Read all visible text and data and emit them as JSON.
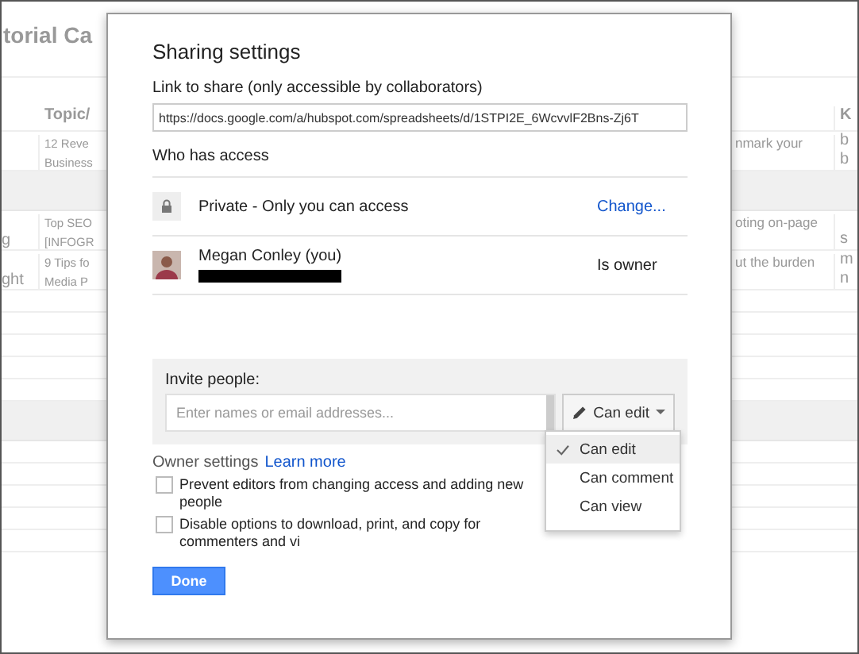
{
  "spreadsheet": {
    "title": "torial Ca",
    "header": {
      "column_2": "Topic/",
      "column_4": "K"
    },
    "rows": [
      {
        "kind": "data",
        "column_1": "",
        "column_2": [
          "12 Reve",
          "Business"
        ],
        "column_3": "nmark your",
        "column_4": [
          "b",
          "b"
        ]
      },
      {
        "kind": "band"
      },
      {
        "kind": "data",
        "column_1": "g",
        "column_2": [
          "Top SEO",
          "[INFOGR"
        ],
        "column_3": "oting on-page",
        "column_4": [
          "s"
        ]
      },
      {
        "kind": "data",
        "column_1": "ght",
        "column_2": [
          "9 Tips fo",
          "Media P"
        ],
        "column_3": "ut the burden",
        "column_4": [
          "m",
          "n"
        ]
      }
    ]
  },
  "dialog": {
    "title": "Sharing settings",
    "link": {
      "label": "Link to share (only accessible by collaborators)",
      "value": "https://docs.google.com/a/hubspot.com/spreadsheets/d/1STPI2E_6WcvvlF2Bns-Zj6T"
    },
    "access": {
      "heading": "Who has access",
      "entries": [
        {
          "kind": "visibility",
          "text": "Private - Only you can access",
          "action": "Change..."
        },
        {
          "kind": "person",
          "name": "Megan Conley (you)",
          "email_redacted": true,
          "role": "Is owner"
        }
      ]
    },
    "invite": {
      "label": "Invite people:",
      "placeholder": "Enter names or email addresses...",
      "permission": "Can edit",
      "menu": [
        {
          "label": "Can edit",
          "selected": true
        },
        {
          "label": "Can comment",
          "selected": false
        },
        {
          "label": "Can view",
          "selected": false
        }
      ]
    },
    "owner_settings": {
      "label": "Owner settings",
      "link": "Learn more",
      "options": [
        {
          "label": "Prevent editors from changing access and adding new people",
          "checked": false
        },
        {
          "label": "Disable options to download, print, and copy for commenters and vi",
          "checked": false
        }
      ]
    },
    "done": "Done"
  }
}
